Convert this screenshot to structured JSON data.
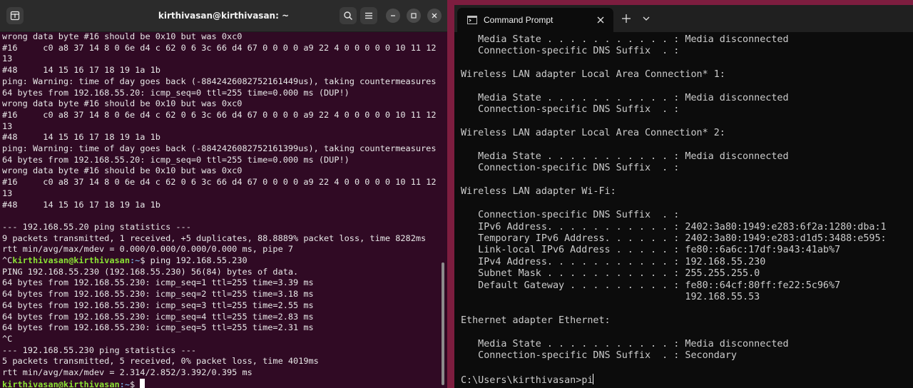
{
  "ubuntu_terminal": {
    "title": "kirthivasan@kirthivasan: ~",
    "icons": {
      "new_tab": "new-tab-icon",
      "search": "search-icon",
      "menu": "hamburger-menu-icon",
      "minimize": "minimize-icon",
      "maximize": "maximize-icon",
      "close": "close-icon"
    },
    "lines": [
      {
        "text": "wrong data byte #16 should be 0x10 but was 0xc0"
      },
      {
        "text": "#16\tc0 a8 37 14 8 0 6e d4 c 62 0 6 3c 66 d4 67 0 0 0 0 a9 22 4 0 0 0 0 0 10 11 12"
      },
      {
        "text": "13"
      },
      {
        "text": "#48\t14 15 16 17 18 19 1a 1b"
      },
      {
        "text": "ping: Warning: time of day goes back (-8842426082752161449us), taking countermeasures"
      },
      {
        "text": "64 bytes from 192.168.55.20: icmp_seq=0 ttl=255 time=0.000 ms (DUP!)"
      },
      {
        "text": "wrong data byte #16 should be 0x10 but was 0xc0"
      },
      {
        "text": "#16\tc0 a8 37 14 8 0 6e d4 c 62 0 6 3c 66 d4 67 0 0 0 0 a9 22 4 0 0 0 0 0 10 11 12"
      },
      {
        "text": "13"
      },
      {
        "text": "#48\t14 15 16 17 18 19 1a 1b"
      },
      {
        "text": "ping: Warning: time of day goes back (-8842426082752161399us), taking countermeasures"
      },
      {
        "text": "64 bytes from 192.168.55.20: icmp_seq=0 ttl=255 time=0.000 ms (DUP!)"
      },
      {
        "text": "wrong data byte #16 should be 0x10 but was 0xc0"
      },
      {
        "text": "#16\tc0 a8 37 14 8 0 6e d4 c 62 0 6 3c 66 d4 67 0 0 0 0 a9 22 4 0 0 0 0 0 10 11 12"
      },
      {
        "text": "13"
      },
      {
        "text": "#48\t14 15 16 17 18 19 1a 1b"
      },
      {
        "text": ""
      },
      {
        "text": "--- 192.168.55.20 ping statistics ---"
      },
      {
        "text": "9 packets transmitted, 1 received, +5 duplicates, 88.8889% packet loss, time 8282ms"
      },
      {
        "text": "rtt min/avg/max/mdev = 0.000/0.000/0.000/0.000 ms, pipe 7"
      },
      {
        "pre": "^C",
        "user": "kirthivasan@kirthivasan",
        "path": ":~",
        "cmd": "$ ping 192.168.55.230"
      },
      {
        "text": "PING 192.168.55.230 (192.168.55.230) 56(84) bytes of data."
      },
      {
        "text": "64 bytes from 192.168.55.230: icmp_seq=1 ttl=255 time=3.39 ms"
      },
      {
        "text": "64 bytes from 192.168.55.230: icmp_seq=2 ttl=255 time=3.18 ms"
      },
      {
        "text": "64 bytes from 192.168.55.230: icmp_seq=3 ttl=255 time=2.55 ms"
      },
      {
        "text": "64 bytes from 192.168.55.230: icmp_seq=4 ttl=255 time=2.83 ms"
      },
      {
        "text": "64 bytes from 192.168.55.230: icmp_seq=5 ttl=255 time=2.31 ms"
      },
      {
        "text": "^C"
      },
      {
        "text": "--- 192.168.55.230 ping statistics ---"
      },
      {
        "text": "5 packets transmitted, 5 received, 0% packet loss, time 4019ms"
      },
      {
        "text": "rtt min/avg/max/mdev = 2.314/2.852/3.392/0.395 ms"
      },
      {
        "pre": "",
        "user": "kirthivasan@kirthivasan",
        "path": ":~",
        "cmd": "$ ",
        "cursor": true
      }
    ]
  },
  "windows_terminal": {
    "tab_title": "Command Prompt",
    "icons": {
      "tab_icon": "command-prompt-icon",
      "close": "close-icon",
      "new_tab": "plus-icon",
      "dropdown": "chevron-down-icon"
    },
    "lines": [
      "   Media State . . . . . . . . . . . : Media disconnected",
      "   Connection-specific DNS Suffix  . :",
      "",
      "Wireless LAN adapter Local Area Connection* 1:",
      "",
      "   Media State . . . . . . . . . . . : Media disconnected",
      "   Connection-specific DNS Suffix  . :",
      "",
      "Wireless LAN adapter Local Area Connection* 2:",
      "",
      "   Media State . . . . . . . . . . . : Media disconnected",
      "   Connection-specific DNS Suffix  . :",
      "",
      "Wireless LAN adapter Wi-Fi:",
      "",
      "   Connection-specific DNS Suffix  . :",
      "   IPv6 Address. . . . . . . . . . . : 2402:3a80:1949:e283:6f2a:1280:dba:1",
      "   Temporary IPv6 Address. . . . . . : 2402:3a80:1949:e283:d1d5:3488:e595:",
      "   Link-local IPv6 Address . . . . . : fe80::6a6c:17df:9a43:41ab%7",
      "   IPv4 Address. . . . . . . . . . . : 192.168.55.230",
      "   Subnet Mask . . . . . . . . . . . : 255.255.255.0",
      "   Default Gateway . . . . . . . . . : fe80::64cf:80ff:fe22:5c96%7",
      "                                       192.168.55.53",
      "",
      "Ethernet adapter Ethernet:",
      "",
      "   Media State . . . . . . . . . . . : Media disconnected",
      "   Connection-specific DNS Suffix  . : Secondary",
      ""
    ],
    "prompt": "C:\\Users\\kirthivasan>",
    "typed": "pi"
  }
}
